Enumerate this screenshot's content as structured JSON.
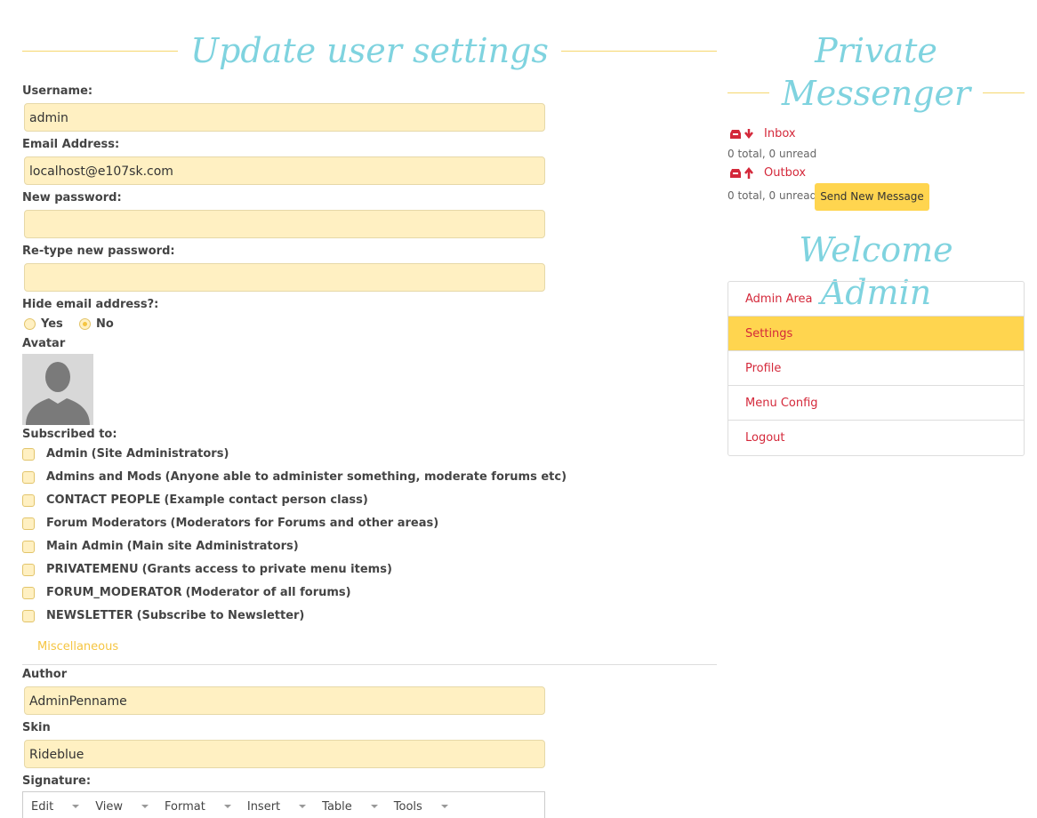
{
  "form": {
    "title": "Update user settings",
    "username_label": "Username:",
    "username_value": "admin",
    "email_label": "Email Address:",
    "email_value": "localhost@e107sk.com",
    "newpass_label": "New password:",
    "retype_label": "Re-type new password:",
    "hide_email_label": "Hide email address?:",
    "hide_yes": "Yes",
    "hide_no": "No",
    "avatar_label": "Avatar",
    "subscribed_label": "Subscribed to:",
    "subscriptions": [
      {
        "name": "Admin",
        "desc": "(Site Administrators)"
      },
      {
        "name": "Admins and Mods",
        "desc": "(Anyone able to administer something, moderate forums etc)"
      },
      {
        "name": "CONTACT PEOPLE",
        "desc": "(Example contact person class)"
      },
      {
        "name": "Forum Moderators",
        "desc": "(Moderators for Forums and other areas)"
      },
      {
        "name": "Main Admin",
        "desc": "(Main site Administrators)"
      },
      {
        "name": "PRIVATEMENU",
        "desc": "(Grants access to private menu items)"
      },
      {
        "name": "FORUM_MODERATOR",
        "desc": "(Moderator of all forums)"
      },
      {
        "name": "NEWSLETTER",
        "desc": "(Subscribe to Newsletter)"
      }
    ],
    "misc_tab": "Miscellaneous",
    "author_label": "Author",
    "author_value": "AdminPenname",
    "skin_label": "Skin",
    "skin_value": "Rideblue",
    "signature_label": "Signature:",
    "toolbar": [
      "Edit",
      "View",
      "Format",
      "Insert",
      "Table",
      "Tools"
    ]
  },
  "pm": {
    "title_line1": "Private",
    "title_line2": "Messenger",
    "inbox": "Inbox",
    "inbox_meta": "0 total, 0 unread",
    "outbox": "Outbox",
    "outbox_meta": "0 total, 0 unread",
    "send_button": "Send New Message"
  },
  "welcome": {
    "title": "Welcome Admin",
    "menu": [
      "Admin Area",
      "Settings",
      "Profile",
      "Menu Config",
      "Logout"
    ],
    "active": "Settings"
  },
  "colors": {
    "accent": "#7fd3df",
    "input_bg": "#fff0c2",
    "link": "#d4283a",
    "highlight": "#ffd54f"
  }
}
